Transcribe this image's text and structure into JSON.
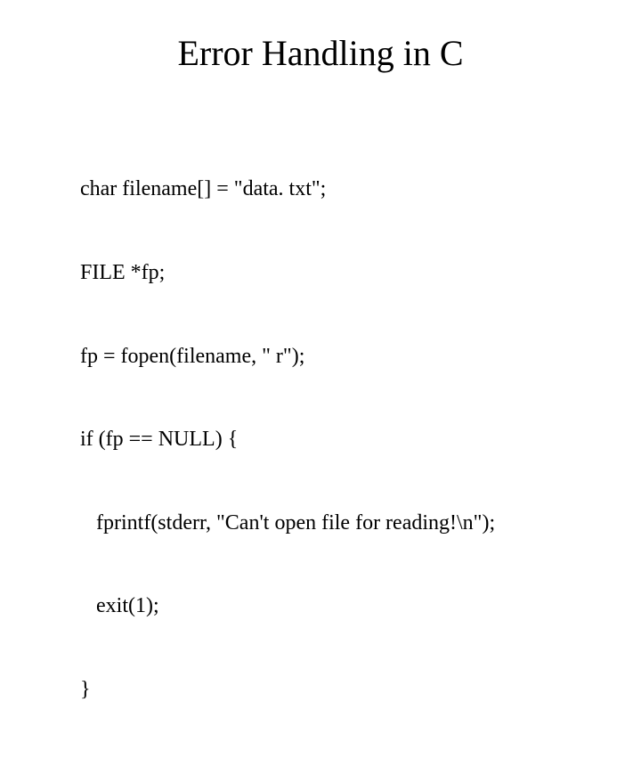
{
  "title": "Error Handling in C",
  "code": {
    "l1": "char filename[] = \"data. txt\";",
    "l2": "FILE *fp;",
    "l3": "fp = fopen(filename, \" r\");",
    "l4": "if (fp == NULL) {",
    "l5": "   fprintf(stderr, \"Can't open file for reading!\\n\");",
    "l6": "   exit(1);",
    "l7": "}"
  }
}
